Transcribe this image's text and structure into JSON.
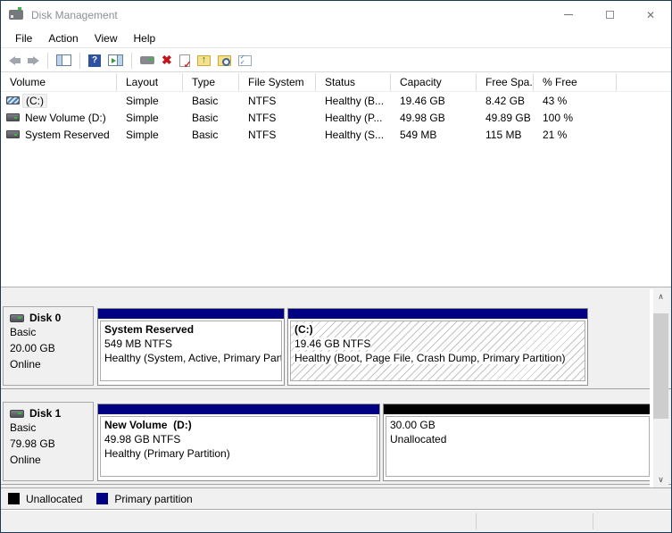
{
  "window": {
    "title": "Disk Management",
    "app_icon": "disk-drive-icon",
    "controls": [
      "minimize",
      "maximize",
      "close"
    ]
  },
  "menu": {
    "items": [
      "File",
      "Action",
      "View",
      "Help"
    ]
  },
  "toolbar": {
    "icons": [
      "back-icon",
      "forward-icon",
      "console-tree-icon",
      "help-icon",
      "action-pane-icon",
      "device-properties-icon",
      "delete-volume-icon",
      "set-active-icon",
      "open-folder-icon",
      "explore-folder-icon",
      "view-options-icon"
    ]
  },
  "volume_list": {
    "columns": [
      "Volume",
      "Layout",
      "Type",
      "File System",
      "Status",
      "Capacity",
      "Free Spa...",
      "% Free"
    ],
    "rows": [
      {
        "icon": "striped-blue-volume-icon",
        "volume": "(C:)",
        "layout": "Simple",
        "type": "Basic",
        "file_system": "NTFS",
        "status": "Healthy (B...",
        "capacity": "19.46 GB",
        "free_space": "8.42 GB",
        "pct_free": "43 %"
      },
      {
        "icon": "plain-volume-icon",
        "volume": "New Volume (D:)",
        "layout": "Simple",
        "type": "Basic",
        "file_system": "NTFS",
        "status": "Healthy (P...",
        "capacity": "49.98 GB",
        "free_space": "49.89 GB",
        "pct_free": "100 %"
      },
      {
        "icon": "plain-volume-icon",
        "volume": "System Reserved",
        "layout": "Simple",
        "type": "Basic",
        "file_system": "NTFS",
        "status": "Healthy (S...",
        "capacity": "549 MB",
        "free_space": "115 MB",
        "pct_free": "21 %"
      }
    ]
  },
  "graph": {
    "disks": [
      {
        "name": "Disk 0",
        "type": "Basic",
        "size": "20.00 GB",
        "status": "Online",
        "partitions": [
          {
            "name": "System Reserved",
            "size": "549 MB NTFS",
            "status": "Healthy (System, Active, Primary Part",
            "kind": "primary"
          },
          {
            "name": "(C:)",
            "size": "19.46 GB NTFS",
            "status": "Healthy (Boot, Page File, Crash Dump, Primary Partition)",
            "kind": "primary-selected"
          }
        ]
      },
      {
        "name": "Disk 1",
        "type": "Basic",
        "size": "79.98 GB",
        "status": "Online",
        "partitions": [
          {
            "name": "New Volume  (D:)",
            "size": "49.98 GB NTFS",
            "status": "Healthy (Primary Partition)",
            "kind": "primary"
          },
          {
            "name": "",
            "size": "30.00 GB",
            "status": "Unallocated",
            "kind": "unallocated"
          }
        ]
      }
    ]
  },
  "legend": {
    "items": [
      {
        "label": "Unallocated",
        "color": "#000000"
      },
      {
        "label": "Primary partition",
        "color": "#000082"
      }
    ]
  },
  "colors": {
    "primary_partition": "#000082",
    "unallocated": "#000000",
    "window_border": "#1d3a57",
    "graph_background": "#f0f0f0",
    "selected_hatch_line": "#c3c3c3"
  }
}
